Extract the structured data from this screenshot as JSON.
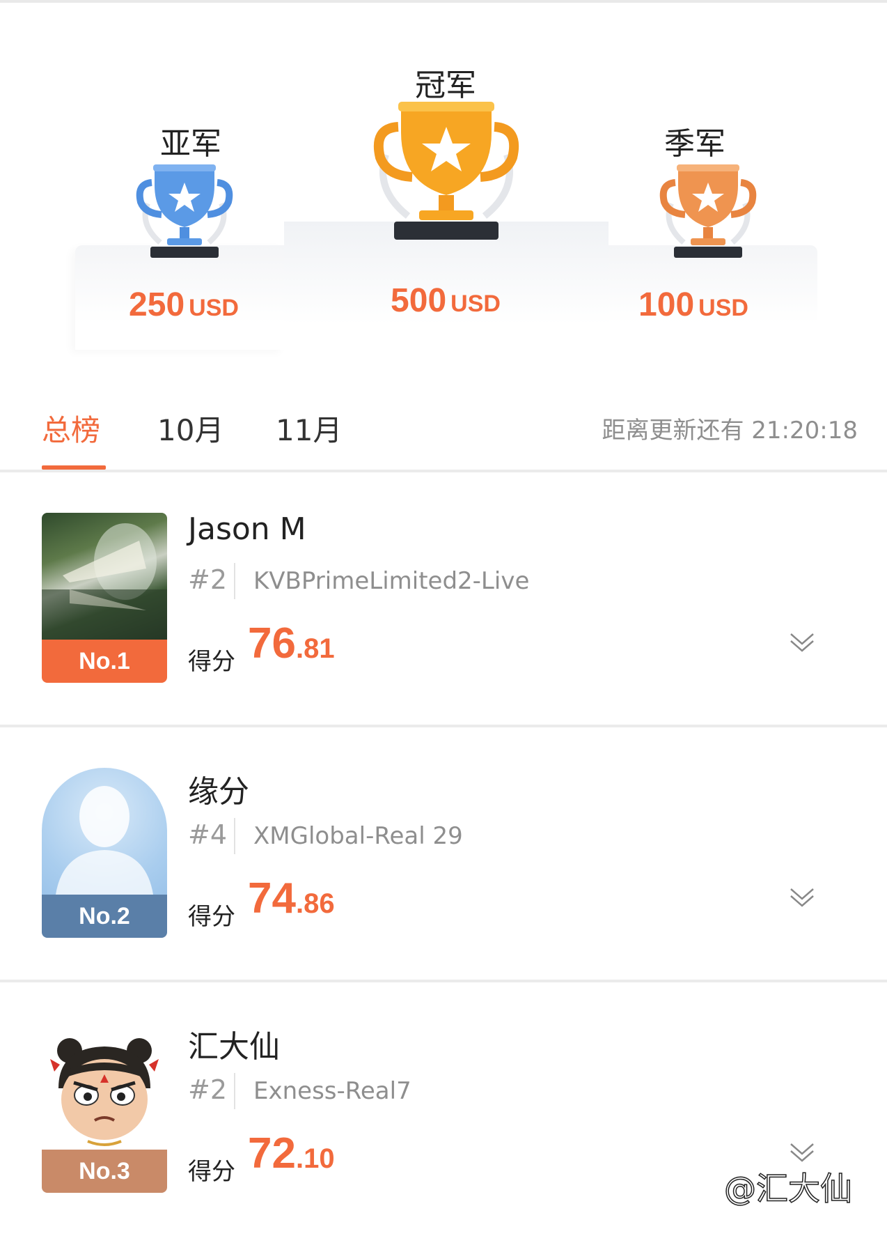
{
  "podium": {
    "second": {
      "title": "亚军",
      "amount": "250",
      "unit": "USD"
    },
    "first": {
      "title": "冠军",
      "amount": "500",
      "unit": "USD"
    },
    "third": {
      "title": "季军",
      "amount": "100",
      "unit": "USD"
    }
  },
  "tabs": {
    "items": [
      "总榜",
      "10月",
      "11月"
    ],
    "active_index": 0,
    "update_label": "距离更新还有 21:20:18"
  },
  "entries": [
    {
      "badge": "No.1",
      "badge_color": "#f26a3c",
      "name": "Jason M",
      "rank": "#2",
      "account": "KVBPrimeLimited2-Live",
      "score_label": "得分",
      "score_int": "76",
      "score_dec": ".81",
      "avatar_icon": "landscape-photo-avatar"
    },
    {
      "badge": "No.2",
      "badge_color": "#5a7fa8",
      "name": "缘分",
      "rank": "#4",
      "account": "XMGlobal-Real 29",
      "score_label": "得分",
      "score_int": "74",
      "score_dec": ".86",
      "avatar_icon": "default-user-avatar"
    },
    {
      "badge": "No.3",
      "badge_color": "#c98a68",
      "name": "汇大仙",
      "rank": "#2",
      "account": "Exness-Real7",
      "score_label": "得分",
      "score_int": "72",
      "score_dec": ".10",
      "avatar_icon": "cartoon-character-avatar"
    }
  ],
  "colors": {
    "accent": "#f26a3c",
    "gold": "#f7a623",
    "silver_blue": "#5b9ae6",
    "bronze": "#ef9450"
  },
  "watermark": "@汇大仙"
}
